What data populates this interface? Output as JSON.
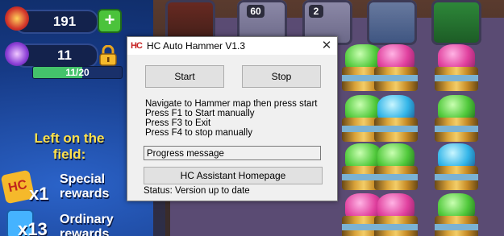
{
  "hud": {
    "coins": "191",
    "hammers": "11",
    "progress_text": "11/20",
    "progress_fraction": 0.55,
    "left_title": "Left on the field:",
    "rewards": [
      {
        "count": "x1",
        "label": "Special rewards"
      },
      {
        "count": "x13",
        "label": "Ordinary rewards"
      }
    ],
    "hc_badge": "HC",
    "badge_a": "60",
    "badge_b": "2"
  },
  "window": {
    "app_icon": "HC",
    "title": "HC Auto Hammer V1.3",
    "close": "✕",
    "start_label": "Start",
    "stop_label": "Stop",
    "instructions": [
      "Navigate to Hammer map then press start",
      "Press F1 to Start manually",
      "Press F3 to Exit",
      "Press F4 to stop manually"
    ],
    "progress_message": "Progress message",
    "homepage_label": "HC Assistant Homepage",
    "status": "Status: Version up to date"
  }
}
